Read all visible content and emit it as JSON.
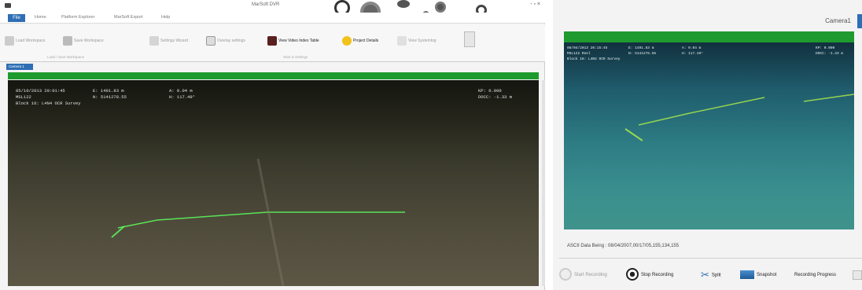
{
  "left_window": {
    "title": "MarSoft DVR",
    "window_controls": "- ▫ ×",
    "menu": {
      "file": "File",
      "items": [
        "Home",
        "Platform Explorer",
        "MarSoft Export",
        "Help"
      ]
    },
    "ribbon": {
      "load_workspace": "Load Workspace",
      "save_workspace": "Save Workspace",
      "settings_wizard": "Settings Wizard",
      "overlay_settings": "Overlay settings",
      "view_video_index": "View Video Index Table",
      "project_details": "Project Details",
      "view_systemlog": "View Systemlog",
      "group_workspace": "Load / save Workspace",
      "group_settings": "Start & Settings"
    },
    "camera_tab": "Camera 1",
    "overlay": {
      "datetime": "05/10/2013 20:01:45",
      "e_value": "E: 1491.83 m",
      "a_value": "A: 0.04 m",
      "kp": "KP: 0.000",
      "vessel": "MSL122",
      "n_value": "N: 5141278.55",
      "h_value": "H: 117.49°",
      "docc": "DOCC: -1.33 m",
      "block": "Block 16: L4N4 OCR Survey"
    }
  },
  "right_window": {
    "camera_label": "Camera1",
    "overlay": {
      "datetime": "08/04/2013 20:15:45",
      "e_value": "E: 1491.83 m",
      "a_value": "A: 0.04 m",
      "kp": "KP: 0.000",
      "vessel": "MSL122 Reel",
      "n_value": "N: 5141278.55",
      "h_value": "H: 117.49°",
      "docc": "DOCC: -1.33 m",
      "block": "Block 16: L4N4 OCR Survey"
    },
    "ascii_data": "ASCII Data Being : 08/04/2007,00/17/05,155,134,155",
    "controls": {
      "start_recording": "Start Recording",
      "stop_recording": "Stop Recording",
      "split": "Split",
      "snapshot": "Snapshot",
      "recording_progress": "Recording Progress"
    }
  },
  "colors": {
    "accent_blue": "#2f6eb5",
    "status_green": "#1f9a2e",
    "laser_green": "#5cff5c"
  }
}
